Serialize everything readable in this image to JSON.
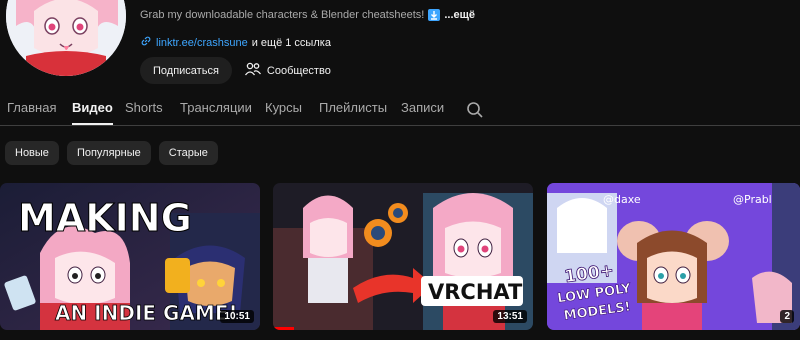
{
  "channel": {
    "description": "Grab my downloadable characters & Blender cheatsheets!",
    "description_more": "...ещё",
    "link_text": "linktr.ee/crashsune",
    "more_links": "и ещё 1 ссылка",
    "subscribe_label": "Подписаться",
    "community_label": "Сообщество"
  },
  "tabs": [
    {
      "label": "Главная",
      "active": false
    },
    {
      "label": "Видео",
      "active": true
    },
    {
      "label": "Shorts",
      "active": false
    },
    {
      "label": "Трансляции",
      "active": false
    },
    {
      "label": "Курсы",
      "active": false
    },
    {
      "label": "Плейлисты",
      "active": false
    },
    {
      "label": "Записи",
      "active": false
    }
  ],
  "chips": [
    {
      "label": "Новые",
      "selected": true
    },
    {
      "label": "Популярные",
      "selected": false
    },
    {
      "label": "Старые",
      "selected": false
    }
  ],
  "videos": [
    {
      "duration": "10:51",
      "thumb_text_top": "MAKING",
      "thumb_text_bottom": "AN INDIE GAME!",
      "watched_fraction": 0
    },
    {
      "duration": "13:51",
      "thumb_text": "VRCHAT",
      "watched_fraction": 0.08
    },
    {
      "duration": "2",
      "thumb_text_handle_1": "@daxe",
      "thumb_text_handle_2": "@Prabl",
      "thumb_text_line1": "100+",
      "thumb_text_line2": "LOW POLY",
      "thumb_text_line3": "MODELS!",
      "watched_fraction": 0
    }
  ],
  "colors": {
    "background": "#0f0f0f",
    "accent_link": "#3ea6ff",
    "chip_selected_bg": "#f1f1f1",
    "progress": "#ff0000"
  },
  "icons": {
    "description_emoji": "download-box-icon",
    "link": "link-icon",
    "community": "people-icon",
    "search": "search-icon"
  }
}
